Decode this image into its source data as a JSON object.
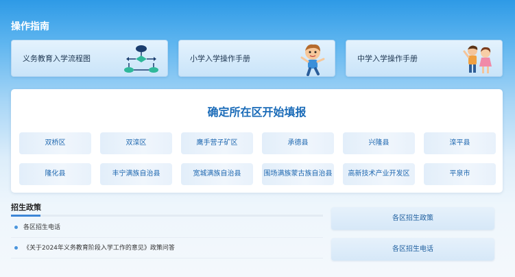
{
  "section_title": "操作指南",
  "guide_cards": [
    {
      "label": "义务教育入学流程图",
      "icon": "flowchart-icon"
    },
    {
      "label": "小学入学操作手册",
      "icon": "boy-icon"
    },
    {
      "label": "中学入学操作手册",
      "icon": "children-icon"
    }
  ],
  "district_panel": {
    "title": "确定所在区开始填报",
    "districts": [
      "双桥区",
      "双滦区",
      "鹰手营子矿区",
      "承德县",
      "兴隆县",
      "滦平县",
      "隆化县",
      "丰宁满族自治县",
      "宽城满族自治县",
      "围场满族蒙古族自治县",
      "高新技术产业开发区",
      "平泉市"
    ]
  },
  "policy": {
    "header": "招生政策",
    "items": [
      "各区招生电话",
      "《关于2024年义务教育阶段入学工作的意见》政策问答"
    ]
  },
  "side_buttons": [
    "各区招生政策",
    "各区招生电话"
  ],
  "colors": {
    "accent": "#3c86d6",
    "district_text": "#1f68b0",
    "title_blue": "#1a6bb8"
  }
}
